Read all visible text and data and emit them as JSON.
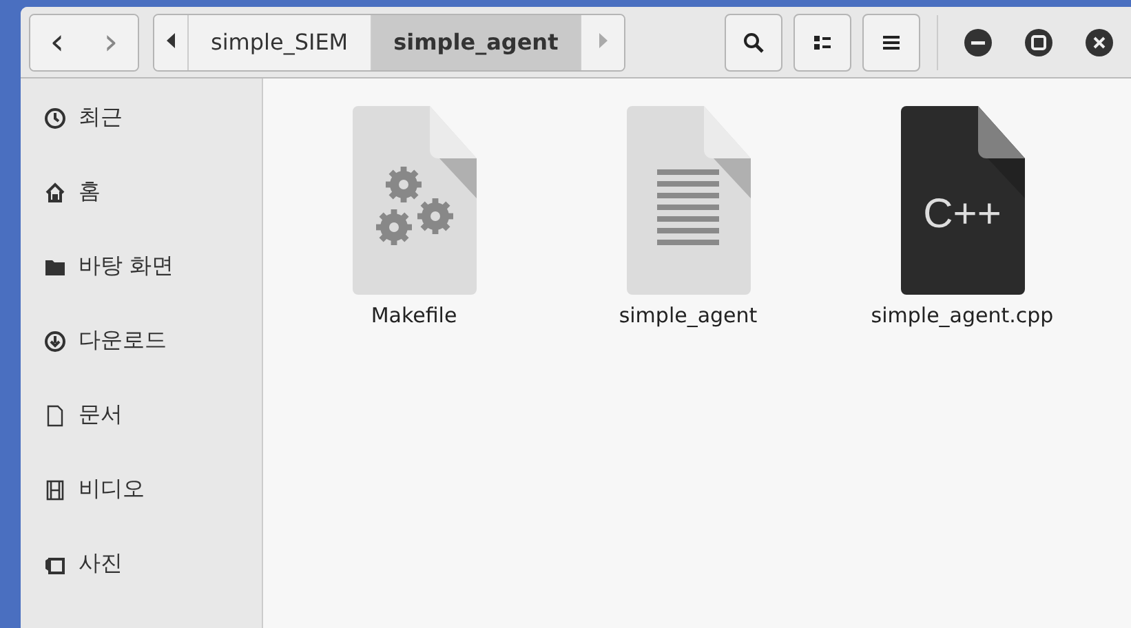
{
  "toolbar": {
    "back": "‹",
    "forward": "›",
    "path": [
      {
        "label": "simple_SIEM",
        "selected": false
      },
      {
        "label": "simple_agent",
        "selected": true
      }
    ]
  },
  "sidebar": {
    "items": [
      {
        "kind": "recent",
        "label": "최근"
      },
      {
        "kind": "home",
        "label": "홈"
      },
      {
        "kind": "folder",
        "label": "바탕 화면"
      },
      {
        "kind": "download",
        "label": "다운로드"
      },
      {
        "kind": "document",
        "label": "문서"
      },
      {
        "kind": "video",
        "label": "비디오"
      },
      {
        "kind": "photo",
        "label": "사진"
      }
    ]
  },
  "files": [
    {
      "kind": "makefile",
      "name": "Makefile"
    },
    {
      "kind": "text",
      "name": "simple_agent"
    },
    {
      "kind": "cpp",
      "name": "simple_agent.cpp",
      "badge": "C++"
    }
  ]
}
